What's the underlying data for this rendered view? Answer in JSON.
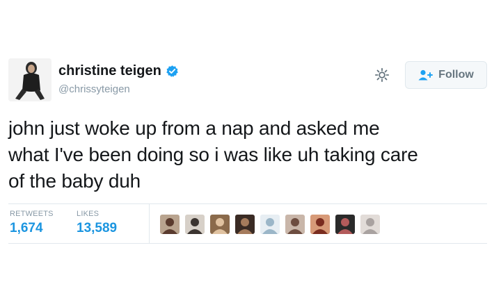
{
  "user": {
    "display_name": "christine teigen",
    "handle": "@chrissyteigen",
    "verified": true,
    "avatar_icon": "profile-photo"
  },
  "actions": {
    "settings_icon": "gear-icon",
    "follow_label": "Follow",
    "follow_icon": "add-user-icon"
  },
  "tweet": {
    "text": "john just woke up from a nap and asked me\nwhat I've been doing so i was like uh taking care\nof the baby duh"
  },
  "stats": {
    "retweets_label": "RETWEETS",
    "retweets_count": "1,674",
    "likes_label": "LIKES",
    "likes_count": "13,589"
  },
  "likers": [
    {
      "icon": "liker-avatar",
      "bg": "#b9a48f",
      "fg": "#5a3b2e"
    },
    {
      "icon": "liker-avatar",
      "bg": "#d7d0c8",
      "fg": "#3b3430"
    },
    {
      "icon": "liker-avatar",
      "bg": "#8a6a4b",
      "fg": "#e0c2a0"
    },
    {
      "icon": "liker-avatar",
      "bg": "#3a2b24",
      "fg": "#a57b5c"
    },
    {
      "icon": "liker-avatar",
      "bg": "#e7eef3",
      "fg": "#9bb6c8"
    },
    {
      "icon": "liker-avatar",
      "bg": "#c9b6a9",
      "fg": "#6d4d40"
    },
    {
      "icon": "liker-avatar",
      "bg": "#d79a78",
      "fg": "#7a2c1f"
    },
    {
      "icon": "liker-avatar",
      "bg": "#2a2a2a",
      "fg": "#b35b5b"
    },
    {
      "icon": "liker-avatar",
      "bg": "#e2dcd8",
      "fg": "#a9a2a0"
    }
  ],
  "colors": {
    "link_blue": "#1b95e0",
    "verified_blue": "#1da1f2",
    "muted_gray": "#8899a6"
  }
}
